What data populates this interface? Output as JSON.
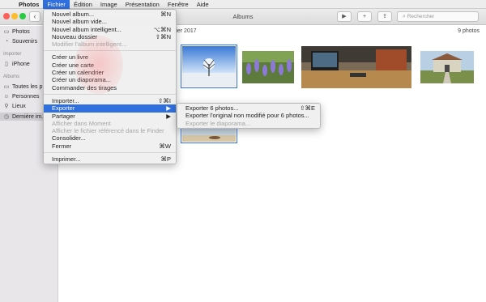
{
  "menubar": {
    "items": [
      {
        "label": "Photos"
      },
      {
        "label": "Fichier"
      },
      {
        "label": "Édition"
      },
      {
        "label": "Image"
      },
      {
        "label": "Présentation"
      },
      {
        "label": "Fenêtre"
      },
      {
        "label": "Aide"
      }
    ]
  },
  "window": {
    "title": "Albums",
    "back": "‹",
    "toolbar": {
      "play": "▶",
      "add": "+",
      "share": "⇪"
    },
    "search_placeholder": "Rechercher"
  },
  "sidebar": {
    "items": [
      {
        "label": "Photos"
      },
      {
        "label": "Souvenirs"
      },
      {
        "label": "iPhone"
      },
      {
        "label": "Toutes les p..."
      },
      {
        "label": "Personnes"
      },
      {
        "label": "Lieux"
      },
      {
        "label": "Dernière im..."
      }
    ],
    "sections": {
      "import": "Importer",
      "albums": "Albums"
    }
  },
  "main": {
    "date": "rier 2017",
    "count": "9 photos"
  },
  "file_menu": {
    "rows": [
      {
        "label": "Nouvel album...",
        "shortcut": "⌘N"
      },
      {
        "label": "Nouvel album vide...",
        "shortcut": ""
      },
      {
        "label": "Nouvel album intelligent...",
        "shortcut": "⌥⌘N"
      },
      {
        "label": "Nouveau dossier",
        "shortcut": "⇧⌘N"
      },
      {
        "label": "Modifier l'album intelligent...",
        "shortcut": ""
      },
      {
        "label": "Créer un livre",
        "shortcut": ""
      },
      {
        "label": "Créer une carte",
        "shortcut": ""
      },
      {
        "label": "Créer un calendrier",
        "shortcut": ""
      },
      {
        "label": "Créer un diaporama...",
        "shortcut": ""
      },
      {
        "label": "Commander des tirages",
        "shortcut": ""
      },
      {
        "label": "Importer...",
        "shortcut": "⇧⌘I"
      },
      {
        "label": "Exporter",
        "shortcut": "▶"
      },
      {
        "label": "Partager",
        "shortcut": "▶"
      },
      {
        "label": "Afficher dans Moment",
        "shortcut": ""
      },
      {
        "label": "Afficher le fichier référencé dans le Finder",
        "shortcut": ""
      },
      {
        "label": "Consolider...",
        "shortcut": ""
      },
      {
        "label": "Fermer",
        "shortcut": "⌘W"
      },
      {
        "label": "Imprimer...",
        "shortcut": "⌘P"
      }
    ]
  },
  "export_submenu": {
    "rows": [
      {
        "label": "Exporter 6 photos...",
        "shortcut": "⇧⌘E"
      },
      {
        "label": "Exporter l'original non modifié pour 6 photos...",
        "shortcut": ""
      },
      {
        "label": "Exporter le diaporama...",
        "shortcut": ""
      }
    ]
  },
  "colors": {
    "accent": "#2f6fde",
    "close": "#fc5f57",
    "minimize": "#fdbb2e",
    "maximize": "#29c940"
  }
}
